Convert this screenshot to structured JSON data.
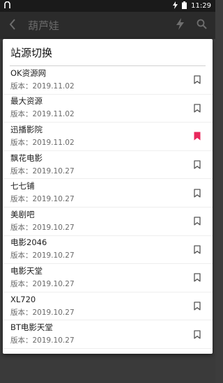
{
  "status_bar": {
    "time": "11:29",
    "icons": [
      "notification-icon",
      "flash-icon",
      "battery-icon"
    ]
  },
  "toolbar": {
    "title": "葫芦娃",
    "icons": [
      "back-arrow-icon",
      "flash-icon",
      "search-icon"
    ]
  },
  "dialog": {
    "title": "站源切换",
    "accent_color": "#e8285c",
    "items": [
      {
        "name": "OK资源网",
        "version": "版本：2019.11.02",
        "selected": false
      },
      {
        "name": "最大资源",
        "version": "版本：2019.11.02",
        "selected": false
      },
      {
        "name": "迅播影院",
        "version": "版本：2019.11.02",
        "selected": true
      },
      {
        "name": "飘花电影",
        "version": "版本：2019.10.27",
        "selected": false
      },
      {
        "name": "七七铺",
        "version": "版本：2019.10.27",
        "selected": false
      },
      {
        "name": "美剧吧",
        "version": "版本：2019.10.27",
        "selected": false
      },
      {
        "name": "电影2046",
        "version": "版本：2019.10.27",
        "selected": false
      },
      {
        "name": "电影天堂",
        "version": "版本：2019.10.27",
        "selected": false
      },
      {
        "name": "XL720",
        "version": "版本：2019.10.27",
        "selected": false
      },
      {
        "name": "BT电影天堂",
        "version": "版本：2019.10.27",
        "selected": false
      }
    ]
  }
}
